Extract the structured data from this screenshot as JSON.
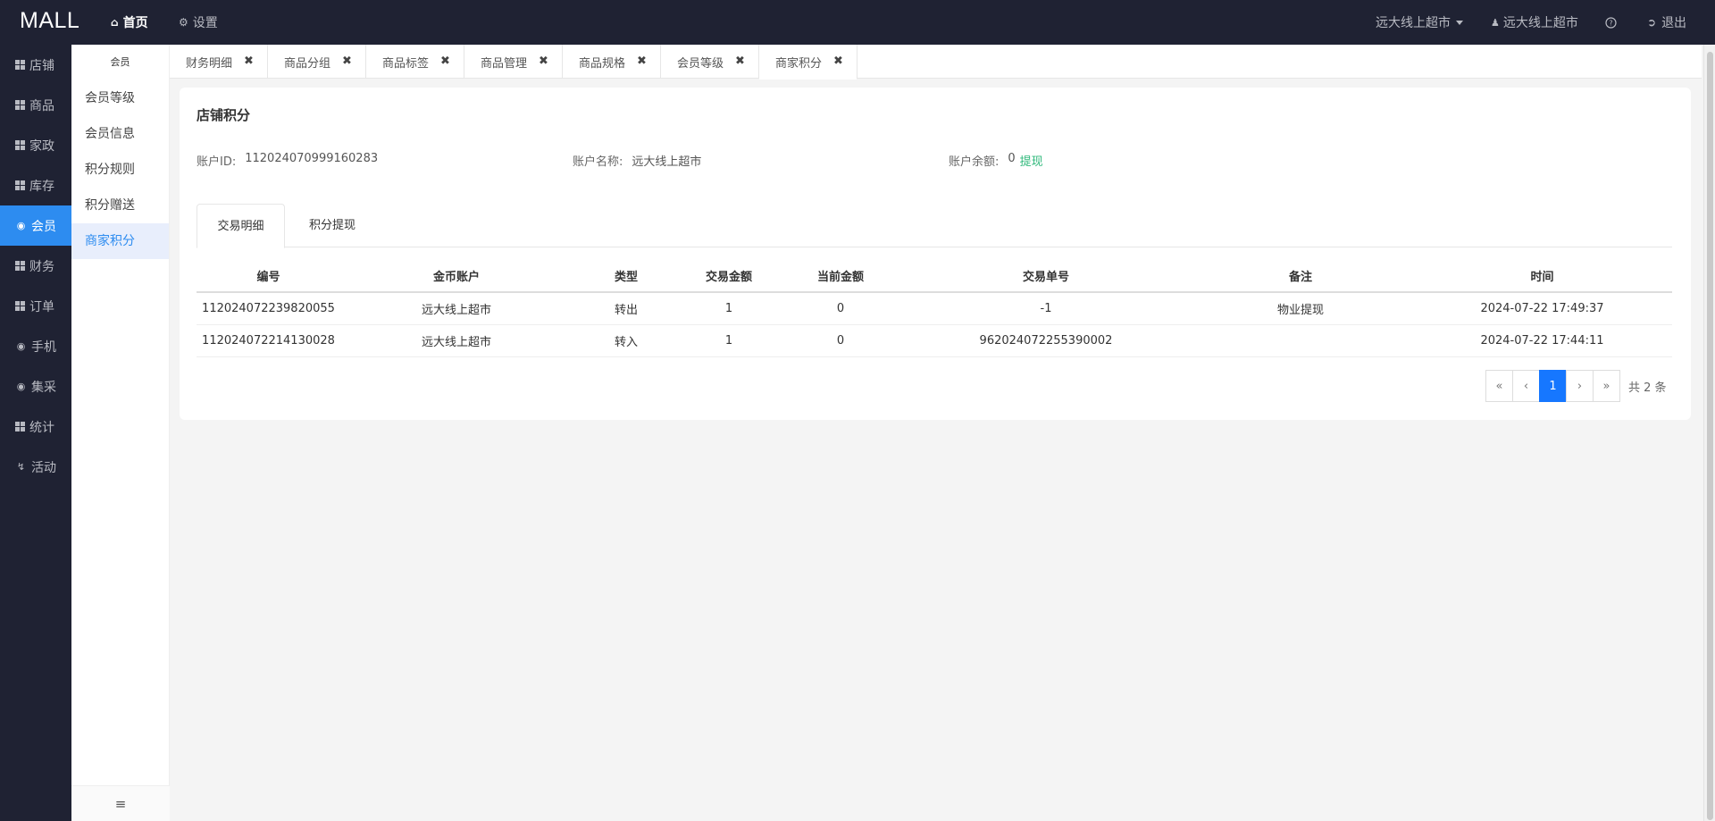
{
  "app": {
    "logo": "MALL"
  },
  "topnav": {
    "home_label": "首页",
    "settings_label": "设置",
    "store_selector": "远大线上超市",
    "user_label": "远大线上超市",
    "help_icon": "question-circle-icon",
    "logout_label": "退出"
  },
  "sidebar": {
    "items": [
      {
        "label": "店铺",
        "icon": "grid-icon"
      },
      {
        "label": "商品",
        "icon": "grid-icon"
      },
      {
        "label": "家政",
        "icon": "grid-icon"
      },
      {
        "label": "库存",
        "icon": "grid-icon"
      },
      {
        "label": "会员",
        "icon": "globe-icon"
      },
      {
        "label": "财务",
        "icon": "grid-icon"
      },
      {
        "label": "订单",
        "icon": "grid-icon"
      },
      {
        "label": "手机",
        "icon": "globe-icon"
      },
      {
        "label": "集采",
        "icon": "globe-icon"
      },
      {
        "label": "统计",
        "icon": "grid-icon"
      },
      {
        "label": "活动",
        "icon": "bolt-icon"
      }
    ],
    "active": "会员"
  },
  "submenu": {
    "title": "会员",
    "items": [
      "会员等级",
      "会员信息",
      "积分规则",
      "积分赠送",
      "商家积分"
    ],
    "active": "商家积分"
  },
  "tabs": [
    "财务明细",
    "商品分组",
    "商品标签",
    "商品管理",
    "商品规格",
    "会员等级",
    "商家积分"
  ],
  "active_tab": "商家积分",
  "main": {
    "title": "店铺积分",
    "account_id_label": "账户ID:",
    "account_id": "112024070999160283",
    "account_name_label": "账户名称:",
    "account_name": "远大线上超市",
    "balance_label": "账户余额:",
    "balance": "0",
    "withdraw_link": "提现",
    "content_tabs": [
      "交易明细",
      "积分提现"
    ],
    "table": {
      "headers": [
        "编号",
        "金币账户",
        "类型",
        "交易金额",
        "当前金额",
        "交易单号",
        "备注",
        "时间"
      ],
      "rows": [
        [
          "112024072239820055",
          "远大线上超市",
          "转出",
          "1",
          "0",
          "-1",
          "物业提现",
          "2024-07-22 17:49:37"
        ],
        [
          "112024072214130028",
          "远大线上超市",
          "转入",
          "1",
          "0",
          "962024072255390002",
          "",
          "2024-07-22 17:44:11"
        ]
      ]
    },
    "pager": {
      "first": "«",
      "prev": "‹",
      "current": "1",
      "next": "›",
      "last": "»",
      "total": "共 2 条"
    }
  },
  "colors": {
    "nav_bg": "#1f2233",
    "accent": "#2d8cf0",
    "link_green": "#2eb87a"
  }
}
